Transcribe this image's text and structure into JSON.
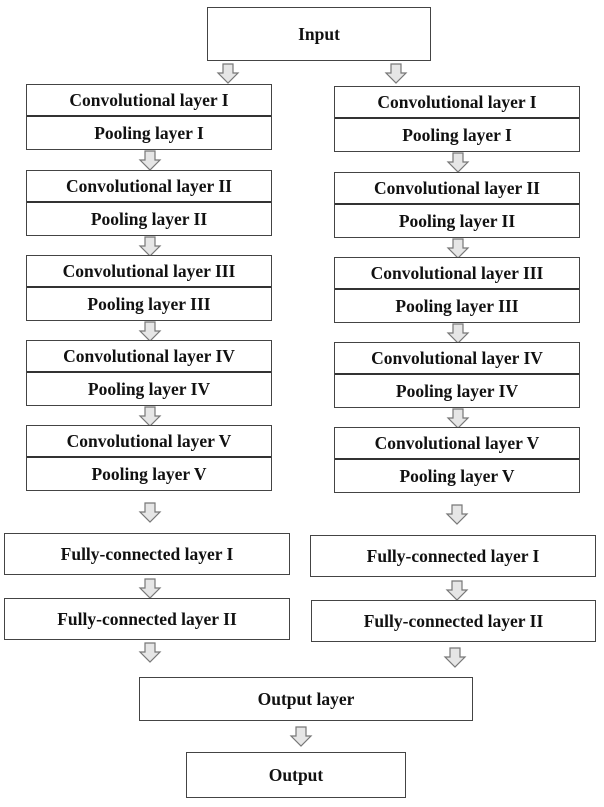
{
  "input": "Input",
  "left_branch": {
    "blocks": [
      {
        "conv": "Convolutional layer I",
        "pool": "Pooling layer I"
      },
      {
        "conv": "Convolutional layer II",
        "pool": "Pooling layer II"
      },
      {
        "conv": "Convolutional layer III",
        "pool": "Pooling layer III"
      },
      {
        "conv": "Convolutional layer IV",
        "pool": "Pooling layer IV"
      },
      {
        "conv": "Convolutional layer V",
        "pool": "Pooling layer V"
      }
    ],
    "fc": [
      "Fully-connected layer I",
      "Fully-connected layer II"
    ]
  },
  "right_branch": {
    "blocks": [
      {
        "conv": "Convolutional layer I",
        "pool": "Pooling layer I"
      },
      {
        "conv": "Convolutional layer II",
        "pool": "Pooling layer II"
      },
      {
        "conv": "Convolutional layer III",
        "pool": "Pooling layer III"
      },
      {
        "conv": "Convolutional layer IV",
        "pool": "Pooling layer IV"
      },
      {
        "conv": "Convolutional layer V",
        "pool": "Pooling layer V"
      }
    ],
    "fc": [
      "Fully-connected layer I",
      "Fully-connected layer II"
    ]
  },
  "output_layer": "Output layer",
  "output": "Output",
  "colors": {
    "arrow_fill": "#e6e6e6",
    "arrow_stroke": "#777777",
    "border": "#444444"
  }
}
